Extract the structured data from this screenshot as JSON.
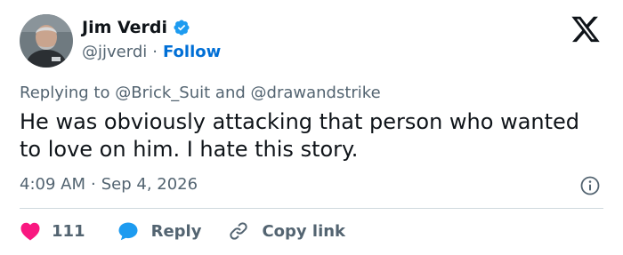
{
  "author": {
    "name": "Jim Verdi",
    "handle": "@jjverdi",
    "separator": "·",
    "follow_label": "Follow",
    "avatar_icon": "user-avatar",
    "verified_icon": "verified-badge-icon"
  },
  "logo_icon": "x-logo-icon",
  "reply_context": {
    "prefix": "Replying to",
    "mention_1": "@Brick_Suit",
    "conjunction": "and",
    "mention_2": "@drawandstrike"
  },
  "tweet": {
    "text": "He was obviously attacking that person who wanted to love on him. I hate this story.",
    "time": "4:09 AM",
    "separator": "·",
    "date": "Sep 4, 2026"
  },
  "actions": {
    "like_count": "111",
    "reply_label": "Reply",
    "copy_label": "Copy link"
  },
  "colors": {
    "accent": "#1d9bf0",
    "like": "#f91880",
    "follow": "#006fd6",
    "secondary_text": "#536471",
    "primary_text": "#0f1419",
    "divider": "#cfd9de"
  }
}
